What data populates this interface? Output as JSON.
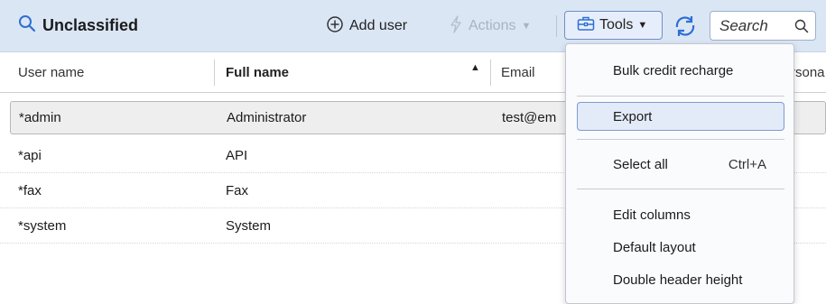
{
  "toolbar": {
    "title": "Unclassified",
    "add_user_label": "Add user",
    "actions_label": "Actions",
    "tools_label": "Tools",
    "search_placeholder": "Search"
  },
  "table": {
    "columns": {
      "user_name": "User name",
      "full_name": "Full name",
      "email": "Email",
      "personal": "rsona"
    },
    "rows": [
      {
        "user_name": "*admin",
        "full_name": "Administrator",
        "email": "test@em"
      },
      {
        "user_name": "*api",
        "full_name": "API",
        "email": ""
      },
      {
        "user_name": "*fax",
        "full_name": "Fax",
        "email": ""
      },
      {
        "user_name": "*system",
        "full_name": "System",
        "email": ""
      }
    ]
  },
  "tools_menu": {
    "items": [
      {
        "label": "Bulk credit recharge"
      },
      {
        "label": "Export"
      },
      {
        "label": "Select all",
        "shortcut": "Ctrl+A"
      },
      {
        "label": "Edit columns"
      },
      {
        "label": "Default layout"
      },
      {
        "label": "Double header height"
      }
    ],
    "highlighted": "Export"
  },
  "colors": {
    "toolbar_bg": "#dbe6f5",
    "accent": "#2f6fd3",
    "highlight_bg": "#e3ebf8",
    "selected_row_bg": "#eeeeee"
  }
}
